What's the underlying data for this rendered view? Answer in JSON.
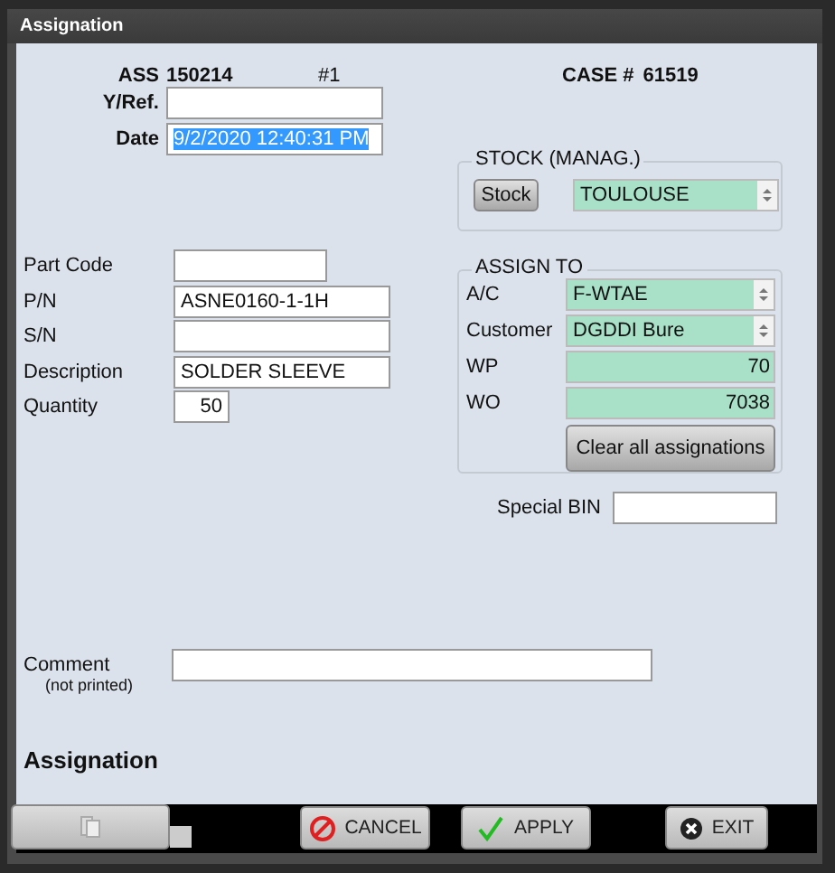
{
  "window": {
    "title": "Assignation"
  },
  "header": {
    "ass_label": "ASS",
    "ass_number": "150214",
    "index": "#1",
    "case_label": "CASE #",
    "case_number": "61519"
  },
  "ref_fields": [
    {
      "label": "Y/Ref."
    },
    {
      "label": "Date",
      "value": "9/2/2020 12:40:31 PM",
      "selected": true
    }
  ],
  "part_fields": [
    {
      "label": "Part Code",
      "kind": "short"
    },
    {
      "label": "P/N",
      "value": "ASNE0160-1-1H",
      "kind": "long"
    },
    {
      "label": "S/N",
      "kind": "long"
    },
    {
      "label": "Description",
      "value": "SOLDER SLEEVE",
      "kind": "long"
    },
    {
      "label": "Quantity",
      "value": "50",
      "kind": "number"
    }
  ],
  "stock": {
    "title": "STOCK (MANAG.)",
    "button": "Stock",
    "location": "TOULOUSE"
  },
  "assign_to": {
    "title": "ASSIGN TO",
    "fields": [
      {
        "label": "A/C",
        "value": "F-WTAE",
        "kind": "dropdown"
      },
      {
        "label": "Customer",
        "value": "DGDDI Bure",
        "kind": "dropdown"
      },
      {
        "label": "WP",
        "value": "70",
        "kind": "number"
      },
      {
        "label": "WO",
        "value": "7038",
        "kind": "number"
      }
    ],
    "clear_button": "Clear all assignations"
  },
  "special_bin": {
    "label": "Special BIN"
  },
  "comment": {
    "label": "Comment",
    "note": "(not printed)"
  },
  "section_title": "Assignation",
  "footer": {
    "buttons": [
      {
        "label": "CANCEL",
        "kind": "cancel"
      },
      {
        "label": "APPLY",
        "kind": "apply"
      },
      {
        "label": "EXIT",
        "kind": "exit"
      }
    ]
  }
}
